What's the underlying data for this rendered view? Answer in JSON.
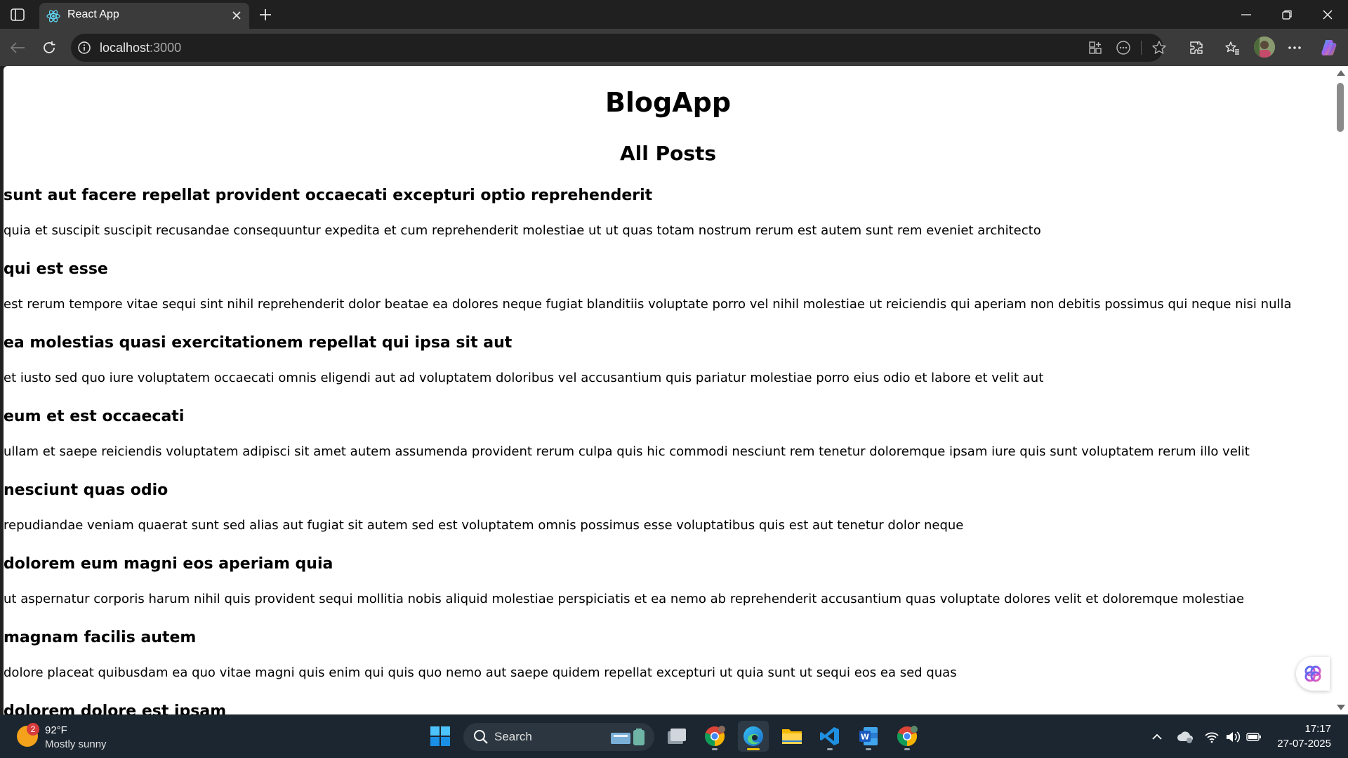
{
  "browser": {
    "tab_title": "React App",
    "url_host": "localhost",
    "url_port": ":3000"
  },
  "page": {
    "app_title": "BlogApp",
    "section_title": "All Posts",
    "posts": [
      {
        "title": "sunt aut facere repellat provident occaecati excepturi optio reprehenderit",
        "body": "quia et suscipit suscipit recusandae consequuntur expedita et cum reprehenderit molestiae ut ut quas totam nostrum rerum est autem sunt rem eveniet architecto"
      },
      {
        "title": "qui est esse",
        "body": "est rerum tempore vitae sequi sint nihil reprehenderit dolor beatae ea dolores neque fugiat blanditiis voluptate porro vel nihil molestiae ut reiciendis qui aperiam non debitis possimus qui neque nisi nulla"
      },
      {
        "title": "ea molestias quasi exercitationem repellat qui ipsa sit aut",
        "body": "et iusto sed quo iure voluptatem occaecati omnis eligendi aut ad voluptatem doloribus vel accusantium quis pariatur molestiae porro eius odio et labore et velit aut"
      },
      {
        "title": "eum et est occaecati",
        "body": "ullam et saepe reiciendis voluptatem adipisci sit amet autem assumenda provident rerum culpa quis hic commodi nesciunt rem tenetur doloremque ipsam iure quis sunt voluptatem rerum illo velit"
      },
      {
        "title": "nesciunt quas odio",
        "body": "repudiandae veniam quaerat sunt sed alias aut fugiat sit autem sed est voluptatem omnis possimus esse voluptatibus quis est aut tenetur dolor neque"
      },
      {
        "title": "dolorem eum magni eos aperiam quia",
        "body": "ut aspernatur corporis harum nihil quis provident sequi mollitia nobis aliquid molestiae perspiciatis et ea nemo ab reprehenderit accusantium quas voluptate dolores velit et doloremque molestiae"
      },
      {
        "title": "magnam facilis autem",
        "body": "dolore placeat quibusdam ea quo vitae magni quis enim qui quis quo nemo aut saepe quidem repellat excepturi ut quia sunt ut sequi eos ea sed quas"
      },
      {
        "title": "dolorem dolore est ipsam",
        "body": ""
      }
    ]
  },
  "taskbar": {
    "weather_temp": "92°F",
    "weather_condition": "Mostly sunny",
    "weather_badge": "2",
    "search_label": "Search",
    "clock_time": "17:17",
    "clock_date": "27-07-2025"
  },
  "icons": {
    "tab_bar": [
      "sidebar-icon",
      "react-icon",
      "close-icon",
      "plus-icon"
    ],
    "window": [
      "minimize-icon",
      "restore-icon",
      "close-icon"
    ],
    "toolbar": [
      "back-icon",
      "refresh-icon",
      "info-icon",
      "app-available-icon",
      "reading-icon",
      "star-icon",
      "extensions-icon",
      "favorites-icon",
      "more-icon",
      "copilot-icon"
    ],
    "taskbar_apps": [
      "windows-start-icon",
      "search-icon",
      "task-view-icon",
      "chrome-icon",
      "edge-icon",
      "file-explorer-icon",
      "vscode-icon",
      "word-icon",
      "chrome-icon"
    ],
    "tray": [
      "chevron-up-icon",
      "onedrive-icon",
      "wifi-icon",
      "volume-icon",
      "battery-icon"
    ]
  },
  "colors": {
    "titlebar_bg": "#202020",
    "toolbar_bg": "#3b3b3b",
    "page_bg": "#ffffff",
    "taskbar_bg": "#1c2630",
    "accent_edge": "#1f8fe0"
  }
}
